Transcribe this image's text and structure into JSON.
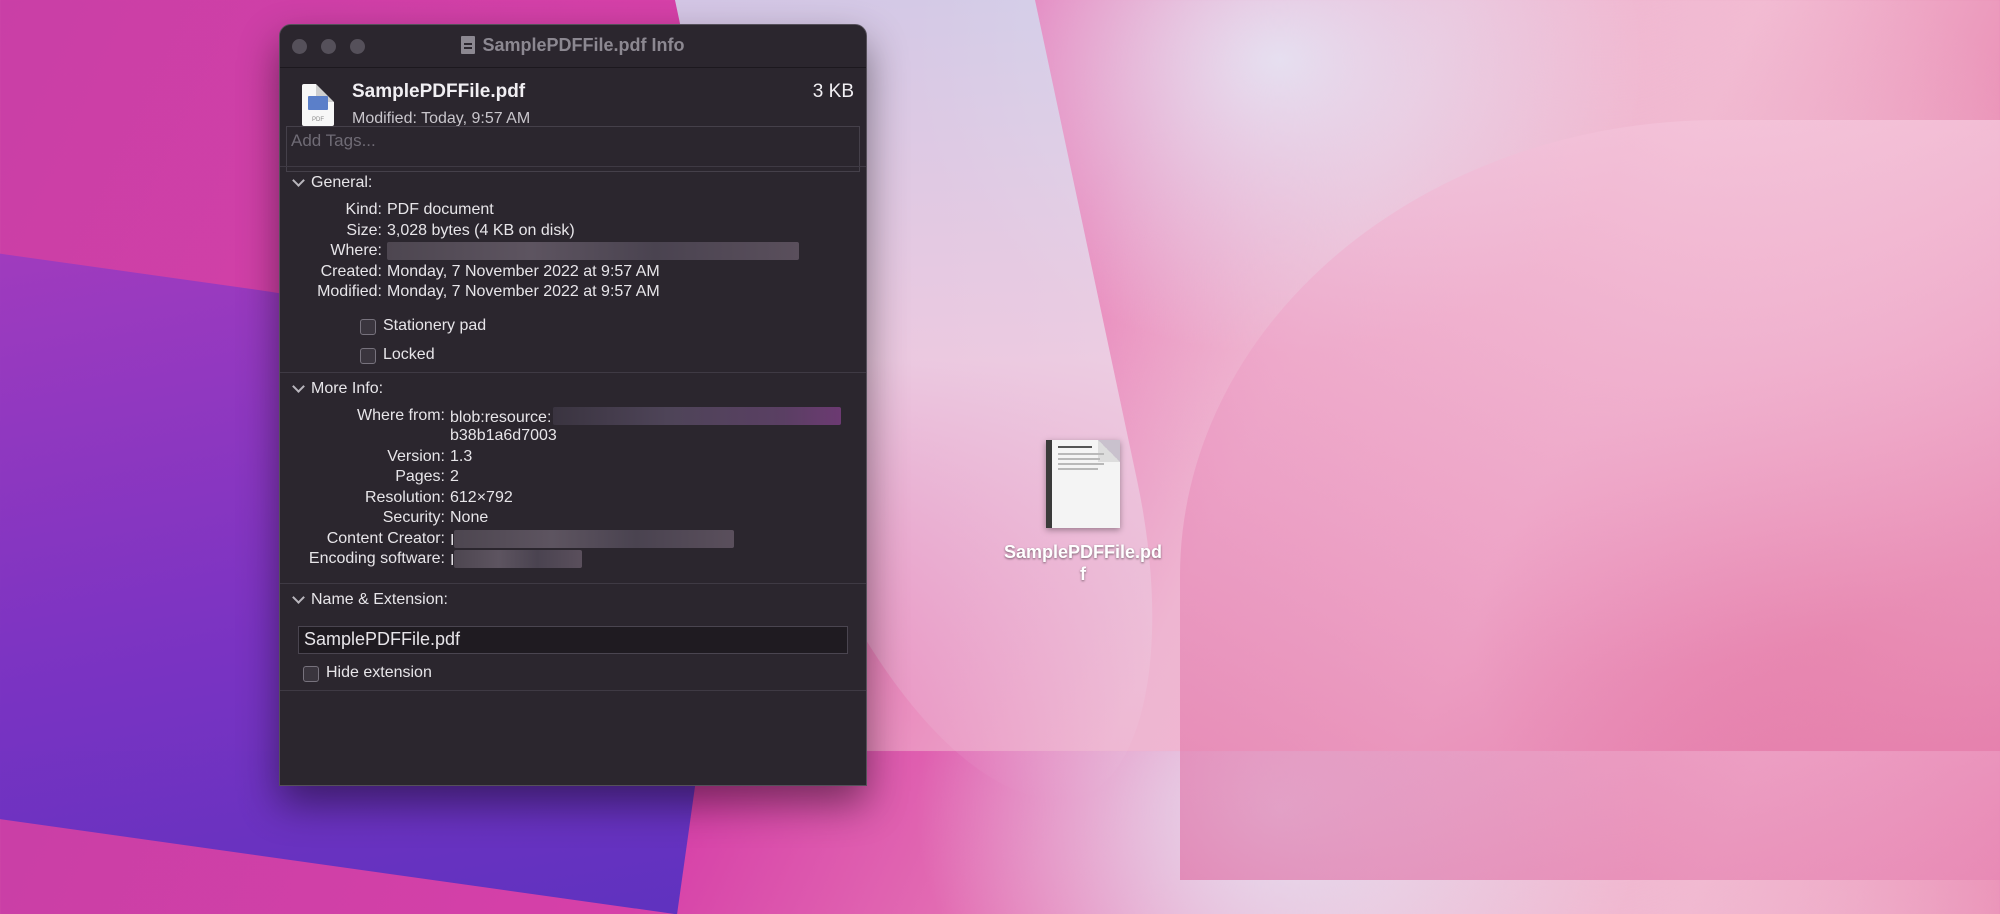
{
  "window": {
    "title": "SamplePDFFile.pdf Info",
    "file_name": "SamplePDFFile.pdf",
    "file_size": "3 KB",
    "modified_summary": "Modified: Today, 9:57 AM",
    "file_icon_label": "PDF",
    "tags_placeholder": "Add Tags..."
  },
  "general": {
    "heading": "General:",
    "rows": [
      {
        "key": "Kind:",
        "value": "PDF document"
      },
      {
        "key": "Size:",
        "value": "3,028 bytes (4 KB on disk)"
      },
      {
        "key": "Where:",
        "value": ""
      },
      {
        "key": "Created:",
        "value": "Monday, 7 November 2022 at 9:57 AM"
      },
      {
        "key": "Modified:",
        "value": "Monday, 7 November 2022 at 9:57 AM"
      }
    ],
    "stationery_label": "Stationery pad",
    "locked_label": "Locked"
  },
  "more_info": {
    "heading": "More Info:",
    "rows": [
      {
        "key": "Where from:",
        "value": "blob:resource:"
      },
      {
        "key": "",
        "value": "b38b1a6d7003"
      },
      {
        "key": "Version:",
        "value": "1.3"
      },
      {
        "key": "Pages:",
        "value": "2"
      },
      {
        "key": "Resolution:",
        "value": "612×792"
      },
      {
        "key": "Security:",
        "value": "None"
      },
      {
        "key": "Content Creator:",
        "value": "I"
      },
      {
        "key": "Encoding software:",
        "value": "I"
      }
    ]
  },
  "name_extension": {
    "heading": "Name & Extension:",
    "field_value": "SamplePDFFile.pdf",
    "hide_extension_label": "Hide extension"
  },
  "desktop_icon": {
    "label": "SamplePDFFile.pdf"
  }
}
